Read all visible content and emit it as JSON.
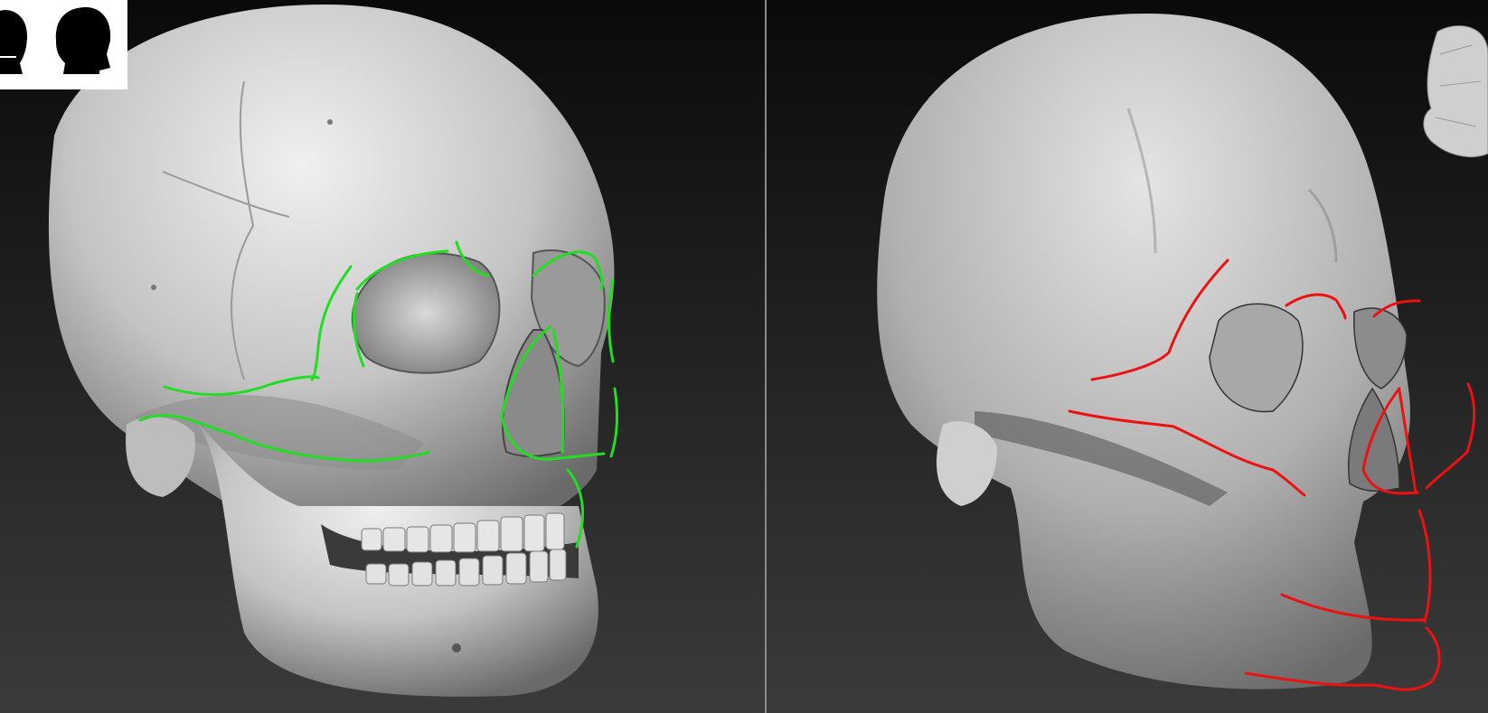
{
  "viewports": {
    "left": {
      "label": ""
    },
    "right": {
      "label": ""
    }
  },
  "thumbnails": [
    {
      "icon": "head-silhouette-icon",
      "view": "side"
    },
    {
      "icon": "head-silhouette-icon",
      "view": "three-quarter"
    }
  ],
  "overlays": {
    "left_line_color": "#22dd22",
    "right_line_color": "#ee1111"
  },
  "colors": {
    "background_top": "#0b0b0b",
    "background_bottom": "#3a3a3a",
    "bone_light": "#e8e8e8",
    "bone_shadow": "#6e6e6e",
    "divider": "#8a8a8a"
  }
}
